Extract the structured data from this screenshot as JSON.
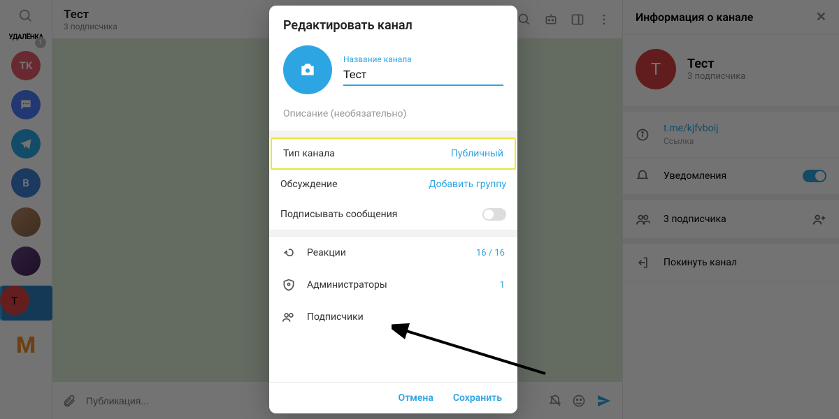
{
  "rail": {
    "udalenka": "УДАЛЁНКА",
    "badge": "1",
    "chips": {
      "tk": "TK",
      "b": "В",
      "t": "T",
      "m": "M"
    }
  },
  "topbar": {
    "title": "Тест",
    "subscribers": "3 подписчика"
  },
  "composer": {
    "placeholder": "Публикация..."
  },
  "rightpanel": {
    "header": "Информация о канале",
    "name": "Тест",
    "letter": "Т",
    "subscribers": "3 подписчика",
    "link": "t.me/kjfvboij",
    "link_label": "Ссылка",
    "notifications": "Уведомления",
    "members": "3 подписчика",
    "leave": "Покинуть канал"
  },
  "modal": {
    "title": "Редактировать канал",
    "name_label": "Название канала",
    "name_value": "Тест",
    "desc_placeholder": "Описание (необязательно)",
    "type_label": "Тип канала",
    "type_value": "Публичный",
    "discussion_label": "Обсуждение",
    "discussion_action": "Добавить группу",
    "sign_label": "Подписывать сообщения",
    "reactions_label": "Реакции",
    "reactions_count": "16 / 16",
    "admins_label": "Администраторы",
    "admins_count": "1",
    "members_label": "Подписчики",
    "cancel": "Отмена",
    "save": "Сохранить"
  }
}
